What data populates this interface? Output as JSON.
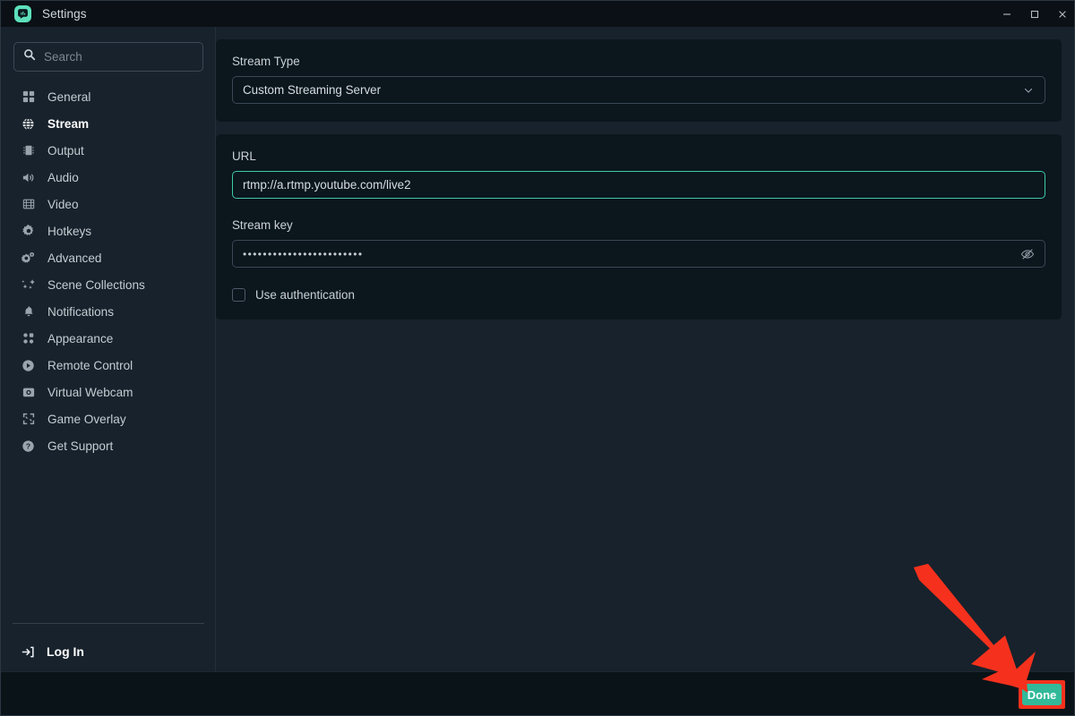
{
  "window": {
    "title": "Settings",
    "logo_icon": "streamlabs-logo-icon",
    "controls": [
      {
        "name": "minimize",
        "icon": "minimize-icon"
      },
      {
        "name": "maximize",
        "icon": "maximize-icon"
      },
      {
        "name": "close",
        "icon": "close-icon"
      }
    ]
  },
  "sidebar": {
    "search": {
      "value": "",
      "placeholder": "Search",
      "icon": "search-icon"
    },
    "items": [
      {
        "label": "General",
        "icon": "grid-icon",
        "key": "general",
        "active": false
      },
      {
        "label": "Stream",
        "icon": "globe-icon",
        "key": "stream",
        "active": true
      },
      {
        "label": "Output",
        "icon": "chip-icon",
        "key": "output",
        "active": false
      },
      {
        "label": "Audio",
        "icon": "speaker-icon",
        "key": "audio",
        "active": false
      },
      {
        "label": "Video",
        "icon": "film-icon",
        "key": "video",
        "active": false
      },
      {
        "label": "Hotkeys",
        "icon": "gear-icon",
        "key": "hotkeys",
        "active": false
      },
      {
        "label": "Advanced",
        "icon": "gears-icon",
        "key": "advanced",
        "active": false
      },
      {
        "label": "Scene Collections",
        "icon": "sparkle-icon",
        "key": "scene-collections",
        "active": false
      },
      {
        "label": "Notifications",
        "icon": "bell-icon",
        "key": "notifications",
        "active": false
      },
      {
        "label": "Appearance",
        "icon": "dots-grid-icon",
        "key": "appearance",
        "active": false
      },
      {
        "label": "Remote Control",
        "icon": "play-circle-icon",
        "key": "remote-control",
        "active": false
      },
      {
        "label": "Virtual Webcam",
        "icon": "camera-icon",
        "key": "virtual-webcam",
        "active": false
      },
      {
        "label": "Game Overlay",
        "icon": "expand-icon",
        "key": "game-overlay",
        "active": false
      },
      {
        "label": "Get Support",
        "icon": "question-icon",
        "key": "get-support",
        "active": false
      }
    ],
    "login": {
      "label": "Log In",
      "icon": "login-arrow-icon"
    }
  },
  "main": {
    "stream_type": {
      "label": "Stream Type",
      "value": "Custom Streaming Server",
      "chevron_icon": "chevron-down-icon",
      "options": [
        "Custom Streaming Server"
      ]
    },
    "url": {
      "label": "URL",
      "value": "rtmp://a.rtmp.youtube.com/live2",
      "focused": true
    },
    "stream_key": {
      "label": "Stream key",
      "value": "••••••••••••••••••••••••",
      "reveal_icon": "eye-slash-icon",
      "masked": true
    },
    "use_authentication": {
      "label": "Use authentication",
      "checked": false
    }
  },
  "footer": {
    "done_label": "Done"
  },
  "annotation": {
    "arrow_color": "#f5311d",
    "highlight_color": "#f5311d",
    "target": "done-button"
  },
  "colors": {
    "accent_teal": "#31b99a",
    "logo_teal": "#5ce0bb",
    "focus_teal": "#3ec9a7",
    "annotation_red": "#f5311d",
    "window_bg": "#17222c",
    "titlebar_bg": "#0a1015",
    "card_bg": "#0b161d",
    "footer_bg": "#0a1318"
  }
}
